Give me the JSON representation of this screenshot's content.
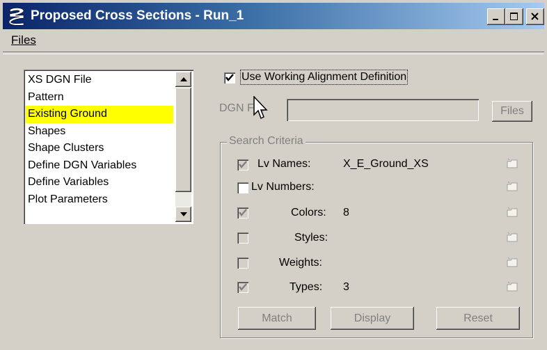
{
  "window": {
    "title": "Proposed Cross Sections - Run_1",
    "buttons": [
      "minimize",
      "maximize",
      "close"
    ]
  },
  "menu": {
    "files": "Files"
  },
  "list": {
    "items": [
      "XS DGN File",
      "Pattern",
      "Existing Ground",
      "Shapes",
      "Shape Clusters",
      "Define DGN Variables",
      "Define Variables",
      "Plot Parameters"
    ],
    "selected": "Existing Ground",
    "selected_color": "#ffff00"
  },
  "alignment": {
    "label": "Use Working Alignment Definition",
    "checked": true
  },
  "dgn": {
    "label": "DGN File",
    "value": "",
    "files_button": "Files"
  },
  "search": {
    "title": "Search Criteria",
    "rows": [
      {
        "label": "Lv Names:",
        "value": "X_E_Ground_XS",
        "checked": true,
        "enabled": false
      },
      {
        "label": "Lv Numbers:",
        "value": "",
        "checked": false,
        "enabled": true
      },
      {
        "label": "Colors:",
        "value": "8",
        "checked": true,
        "enabled": false
      },
      {
        "label": "Styles:",
        "value": "",
        "checked": false,
        "enabled": false
      },
      {
        "label": "Weights:",
        "value": "",
        "checked": false,
        "enabled": false
      },
      {
        "label": "Types:",
        "value": "3",
        "checked": true,
        "enabled": false
      }
    ],
    "buttons": {
      "match": "Match",
      "display": "Display",
      "reset": "Reset"
    }
  }
}
